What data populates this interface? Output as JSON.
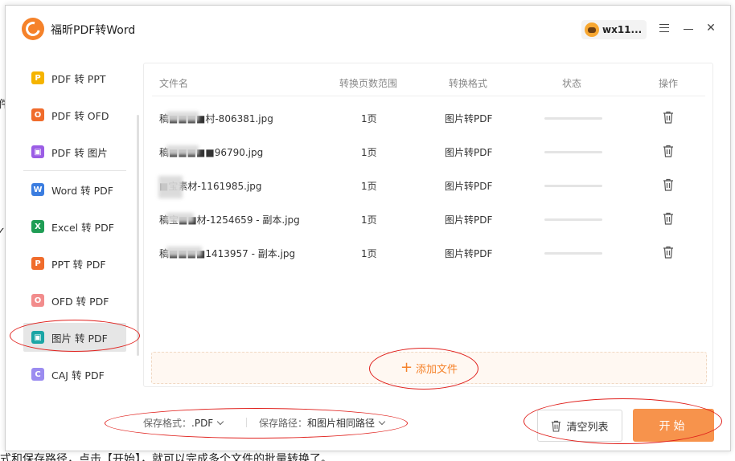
{
  "background": {
    "left_text_1": "件",
    "left_text_2": "✓",
    "bottom_text": "式和保存路径，点击【开始】，就可以完成多个文件的批量转换了。"
  },
  "app": {
    "title": "福昕PDF转Word",
    "user_name": "wx11..."
  },
  "sidebar": {
    "items": [
      {
        "label": "PDF 转 PPT",
        "icon": "ppt-icon",
        "color": "#f5b400",
        "glyph": "P"
      },
      {
        "label": "PDF 转 OFD",
        "icon": "ofd-icon",
        "color": "#f06c2c",
        "glyph": "O"
      },
      {
        "label": "PDF 转 图片",
        "icon": "image-icon",
        "color": "#9b5de5",
        "glyph": "▣"
      },
      {
        "label": "Word 转 PDF",
        "icon": "word-icon",
        "color": "#3b7de0",
        "glyph": "W"
      },
      {
        "label": "Excel 转 PDF",
        "icon": "excel-icon",
        "color": "#1f9d55",
        "glyph": "X"
      },
      {
        "label": "PPT 转 PDF",
        "icon": "ppt-icon",
        "color": "#f06c2c",
        "glyph": "P"
      },
      {
        "label": "OFD 转 PDF",
        "icon": "ofd-icon",
        "color": "#f28c8c",
        "glyph": "O"
      },
      {
        "label": "图片 转 PDF",
        "icon": "image-icon",
        "color": "#1aa5a5",
        "glyph": "▣"
      },
      {
        "label": "CAJ 转 PDF",
        "icon": "caj-icon",
        "color": "#9b8cf0",
        "glyph": "C"
      }
    ],
    "active_index": 7
  },
  "table": {
    "headers": {
      "name": "文件名",
      "pages": "转换页数范围",
      "format": "转换格式",
      "status": "状态",
      "action": "操作"
    },
    "rows": [
      {
        "name": "稿■■■■村-806381.jpg",
        "pages": "1页",
        "format": "图片转PDF",
        "progress": 0
      },
      {
        "name": "稿■■■■■96790.jpg",
        "pages": "1页",
        "format": "图片转PDF",
        "progress": 0
      },
      {
        "name": "■宝素材-1161985.jpg",
        "pages": "1页",
        "format": "图片转PDF",
        "progress": 0
      },
      {
        "name": "稿宝■■材-1254659 - 副本.jpg",
        "pages": "1页",
        "format": "图片转PDF",
        "progress": 0
      },
      {
        "name": "稿■■■■1413957 - 副本.jpg",
        "pages": "1页",
        "format": "图片转PDF",
        "progress": 0
      }
    ]
  },
  "add_files": {
    "plus": "+",
    "label": "添加文件"
  },
  "footer": {
    "format_label": "保存格式：",
    "format_value": ".PDF",
    "path_label": "保存路径：",
    "path_value": "和图片相同路径",
    "clear_label": "清空列表",
    "start_label": "开始"
  },
  "colors": {
    "accent": "#f5822a",
    "start_button": "#f7934c",
    "annotation": "#e0201c"
  }
}
